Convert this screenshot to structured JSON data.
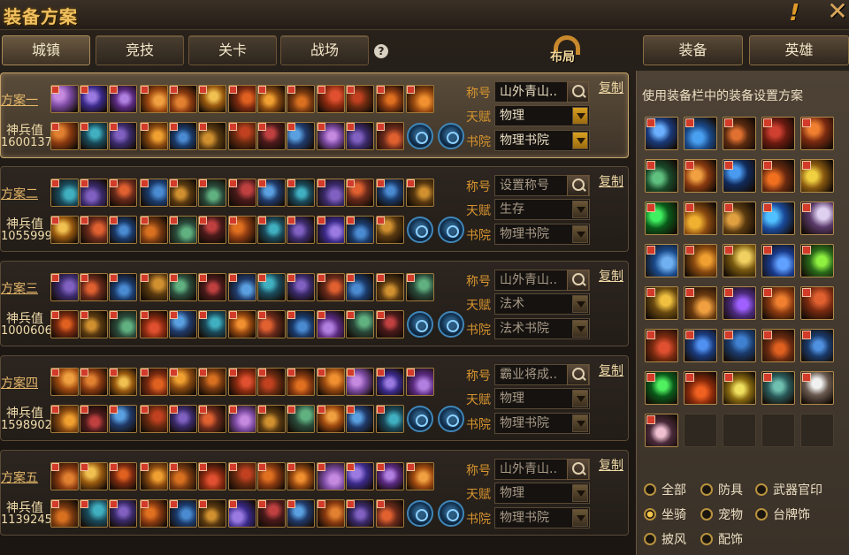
{
  "window": {
    "title": "装备方案"
  },
  "tabs": [
    {
      "label": "城镇",
      "active": true
    },
    {
      "label": "竞技",
      "active": false
    },
    {
      "label": "关卡",
      "active": false
    },
    {
      "label": "战场",
      "active": false
    }
  ],
  "layout_button": {
    "label": "布局"
  },
  "right_tabs": [
    {
      "label": "装备"
    },
    {
      "label": "英雄"
    }
  ],
  "panel_tip": "使用装备栏中的装备设置方案",
  "field_labels": {
    "title": "称号",
    "talent": "天赋",
    "academy": "书院"
  },
  "copy_label": "复制",
  "power_label": "神兵值",
  "plans": [
    {
      "name": "方案一",
      "power": "1600137",
      "title": "山外青山..",
      "talent": "物理",
      "academy": "物理书院",
      "selected": true
    },
    {
      "name": "方案二",
      "power": "1055999",
      "title": "设置称号",
      "talent": "生存",
      "academy": "物理书院",
      "selected": false
    },
    {
      "name": "方案三",
      "power": "1000606",
      "title": "山外青山..",
      "talent": "法术",
      "academy": "法术书院",
      "selected": false
    },
    {
      "name": "方案四",
      "power": "1598902",
      "title": "霸业将成..",
      "talent": "物理",
      "academy": "物理书院",
      "selected": false
    },
    {
      "name": "方案五",
      "power": "1139245",
      "title": "山外青山..",
      "talent": "物理",
      "academy": "物理书院",
      "selected": false
    }
  ],
  "filters": [
    {
      "label": "全部",
      "selected": false
    },
    {
      "label": "防具",
      "selected": false
    },
    {
      "label": "武器官印",
      "selected": false
    },
    {
      "label": "坐骑",
      "selected": true
    },
    {
      "label": "宠物",
      "selected": false
    },
    {
      "label": "台牌饰",
      "selected": false
    },
    {
      "label": "披风",
      "selected": false
    },
    {
      "label": "配饰",
      "selected": false
    }
  ],
  "colors": {
    "gold": "#e6b86a",
    "accent_orange": "#d6942e",
    "selected_radio": "#f2c44a"
  }
}
